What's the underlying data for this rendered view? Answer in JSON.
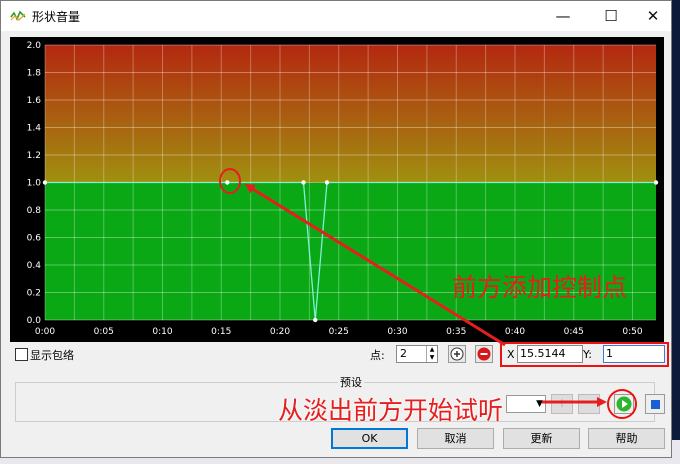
{
  "window": {
    "title": "形状音量",
    "minimize": "—",
    "maximize": "☐",
    "close": "✕"
  },
  "chart_data": {
    "type": "line",
    "y_ticks": [
      "2.0",
      "1.8",
      "1.6",
      "1.4",
      "1.2",
      "1.0",
      "0.8",
      "0.6",
      "0.4",
      "0.2",
      "0.0"
    ],
    "x_ticks": [
      "0:00",
      "0:05",
      "0:10",
      "0:15",
      "0:20",
      "0:25",
      "0:30",
      "0:35",
      "0:40",
      "0:45",
      "0:50"
    ],
    "xlim_seconds": [
      0,
      52
    ],
    "ylim": [
      0,
      2
    ],
    "series": [
      {
        "x_seconds": [
          0,
          15.5144,
          22,
          23,
          24,
          52
        ],
        "y": [
          1,
          1,
          1,
          0,
          1,
          1
        ]
      }
    ],
    "grid": true,
    "colors": {
      "loud_top": "#b42810",
      "mid": "#a09010",
      "quiet": "#0aa814",
      "curve": "#7ff0d8"
    }
  },
  "controls": {
    "show_envelope_label": "显示包络",
    "point_label": "点:",
    "point_value": "2",
    "x_label": "X",
    "x_value": "15.5144",
    "y_label": "Y:",
    "y_value": "1"
  },
  "preset": {
    "label": "预设"
  },
  "buttons": {
    "ok": "OK",
    "cancel": "取消",
    "refresh": "更新",
    "help": "帮助"
  },
  "annotations": {
    "add_point": "前方添加控制点",
    "fade_in": "从淡出前方开始试听"
  }
}
